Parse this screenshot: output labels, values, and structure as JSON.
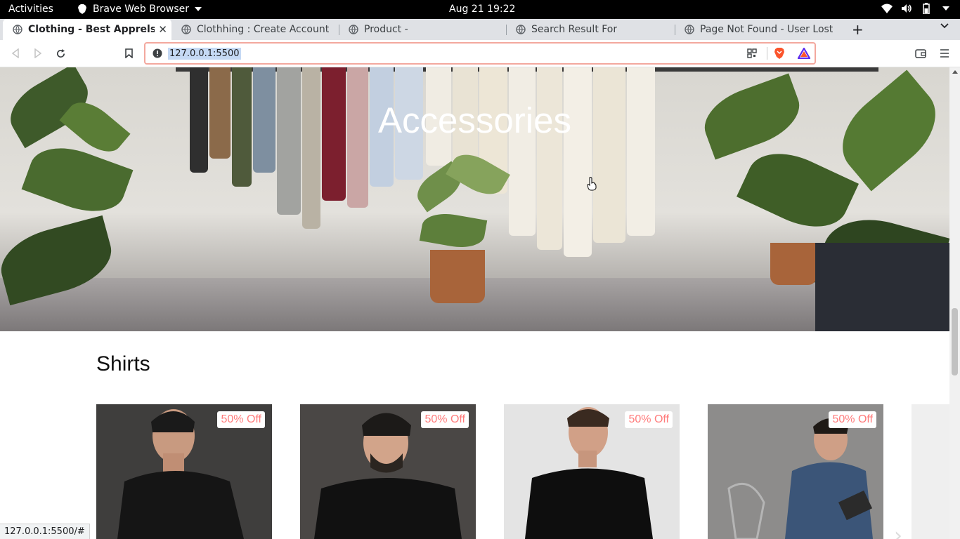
{
  "system_bar": {
    "activities": "Activities",
    "app_name": "Brave Web Browser",
    "clock": "Aug 21  19:22"
  },
  "tabs": [
    {
      "title": "Clothing - Best Apprels On",
      "active": true
    },
    {
      "title": "Clothhing : Create Account",
      "active": false
    },
    {
      "title": "Product -",
      "active": false
    },
    {
      "title": "Search Result For",
      "active": false
    },
    {
      "title": "Page Not Found - User Lost",
      "active": false
    }
  ],
  "toolbar": {
    "url": "127.0.0.1:5500"
  },
  "page": {
    "hero_title": "Accessories",
    "section_title": "Shirts",
    "products": [
      {
        "badge": "50% Off",
        "shirt_color": "#151515"
      },
      {
        "badge": "50% Off",
        "shirt_color": "#111111"
      },
      {
        "badge": "50% Off",
        "shirt_color": "#0e0e0e"
      },
      {
        "badge": "50% Off",
        "shirt_color": "#3b5578"
      }
    ]
  },
  "status_bar": {
    "link": "127.0.0.1:5500/#"
  },
  "colors": {
    "badge_text": "#ff7b7b",
    "omnibox_border": "#f3a89e",
    "selection": "#c5d9f4"
  }
}
